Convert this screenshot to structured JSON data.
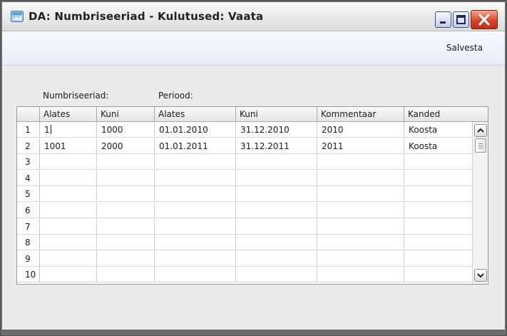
{
  "window": {
    "title": "DA: Numbriseeriad - Kulutused: Vaata"
  },
  "toolbar": {
    "save_label": "Salvesta"
  },
  "labels": {
    "numbriseeriad": "Numbriseeriad:",
    "periood": "Periood:"
  },
  "table": {
    "columns": [
      "Alates",
      "Kuni",
      "Alates",
      "Kuni",
      "Kommentaar",
      "Kanded"
    ],
    "row_numbers": [
      "1",
      "2",
      "3",
      "4",
      "5",
      "6",
      "7",
      "8",
      "9",
      "10"
    ],
    "rows": [
      [
        "1",
        "1000",
        "01.01.2010",
        "31.12.2010",
        "2010",
        "Koosta"
      ],
      [
        "1001",
        "2000",
        "01.01.2011",
        "31.12.2011",
        "2011",
        "Koosta"
      ],
      [
        "",
        "",
        "",
        "",
        "",
        ""
      ],
      [
        "",
        "",
        "",
        "",
        "",
        ""
      ],
      [
        "",
        "",
        "",
        "",
        "",
        ""
      ],
      [
        "",
        "",
        "",
        "",
        "",
        ""
      ],
      [
        "",
        "",
        "",
        "",
        "",
        ""
      ],
      [
        "",
        "",
        "",
        "",
        "",
        ""
      ],
      [
        "",
        "",
        "",
        "",
        "",
        ""
      ],
      [
        "",
        "",
        "",
        "",
        "",
        ""
      ]
    ]
  },
  "icons": {
    "app": "app-window-icon",
    "minimize": "minimize-icon",
    "maximize": "maximize-icon",
    "close": "close-icon",
    "scroll_up": "chevron-up-icon",
    "scroll_down": "chevron-down-icon"
  },
  "colors": {
    "close_button": "#d6462a",
    "toolbar_bg": "#e7eef8",
    "content_bg": "#ebebeb"
  }
}
